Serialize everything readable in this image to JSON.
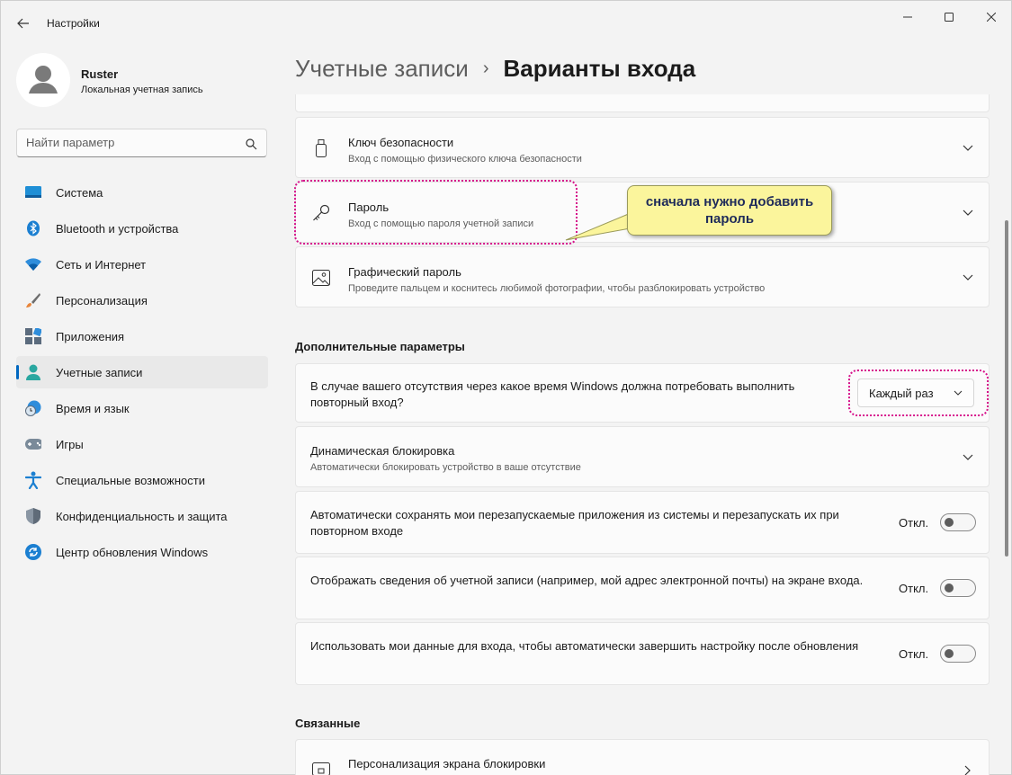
{
  "app": {
    "title": "Настройки"
  },
  "profile": {
    "name": "Ruster",
    "account_type": "Локальная учетная запись"
  },
  "search": {
    "placeholder": "Найти параметр"
  },
  "nav": [
    {
      "label": "Система",
      "icon": "system-icon"
    },
    {
      "label": "Bluetooth и устройства",
      "icon": "bluetooth-icon"
    },
    {
      "label": "Сеть и Интернет",
      "icon": "wifi-icon"
    },
    {
      "label": "Персонализация",
      "icon": "brush-icon"
    },
    {
      "label": "Приложения",
      "icon": "apps-icon"
    },
    {
      "label": "Учетные записи",
      "icon": "accounts-icon",
      "active": true
    },
    {
      "label": "Время и язык",
      "icon": "time-language-icon"
    },
    {
      "label": "Игры",
      "icon": "gamepad-icon"
    },
    {
      "label": "Специальные возможности",
      "icon": "accessibility-icon"
    },
    {
      "label": "Конфиденциальность и защита",
      "icon": "shield-icon"
    },
    {
      "label": "Центр обновления Windows",
      "icon": "update-icon"
    }
  ],
  "breadcrumb": {
    "parent": "Учетные записи",
    "separator": "›",
    "current": "Варианты входа"
  },
  "signin_options": [
    {
      "title": "Ключ безопасности",
      "desc": "Вход с помощью физического ключа безопасности",
      "icon": "usb-key-icon"
    },
    {
      "title": "Пароль",
      "desc": "Вход с помощью пароля учетной записи",
      "icon": "key-icon"
    },
    {
      "title": "Графический пароль",
      "desc": "Проведите пальцем и коснитесь любимой фотографии, чтобы разблокировать устройство",
      "icon": "picture-icon"
    }
  ],
  "additional": {
    "heading": "Дополнительные параметры",
    "require_signin": {
      "text": "В случае вашего отсутствия через какое время Windows должна потребовать выполнить повторный вход?",
      "value": "Каждый раз"
    },
    "dynamic_lock": {
      "title": "Динамическая блокировка",
      "desc": "Автоматически блокировать устройство в ваше отсутствие"
    },
    "toggles": [
      {
        "text": "Автоматически сохранять мои перезапускаемые приложения из системы и перезапускать их при повторном входе",
        "state": "Откл.",
        "on": false
      },
      {
        "text": "Отображать сведения об учетной записи (например, мой адрес электронной почты) на экране входа.",
        "state": "Откл.",
        "on": false
      },
      {
        "text": "Использовать мои данные для входа, чтобы автоматически завершить настройку после обновления",
        "state": "Откл.",
        "on": false
      }
    ]
  },
  "related": {
    "heading": "Связанные",
    "items": [
      {
        "title": "Персонализация экрана блокировки"
      }
    ]
  },
  "annotation": {
    "callout": "сначала нужно добавить пароль",
    "color": "#d6128b",
    "callout_bg": "#fbf59c"
  },
  "colors": {
    "accent": "#0067c0",
    "background": "#f3f3f3",
    "card": "#fbfbfb"
  }
}
